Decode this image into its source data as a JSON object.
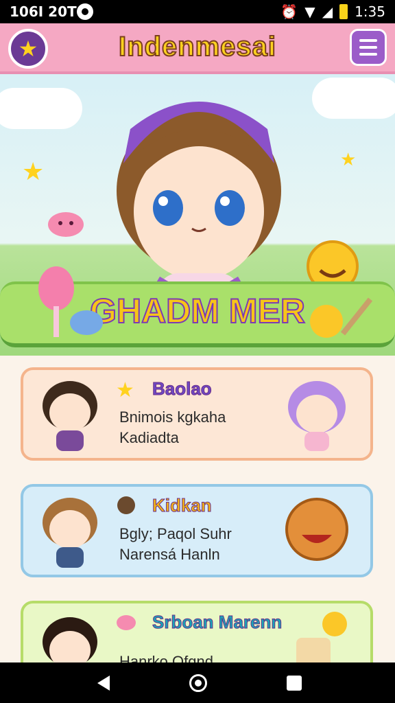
{
  "status": {
    "time_left": "106I 20T",
    "time_right": "1:35"
  },
  "appbar": {
    "title": "Indenmesai",
    "back_icon": "star-icon",
    "menu_icon": "hamburger-icon"
  },
  "hero": {
    "banner_text": "GHADM MER"
  },
  "cards": [
    {
      "heading": "Baolao",
      "line1": "Bnimois kgkaha",
      "line2": "Kadiadta",
      "heading_color": "#6d49c4"
    },
    {
      "heading": "Kidkan",
      "line1": "Bgly; Paqol  Suhr",
      "line2": "Narensá Hanln",
      "heading_color": "#f2b516"
    },
    {
      "heading": "Srboan Marenn",
      "line1": "Hanrko Ofgnd",
      "line2": "",
      "heading_color": "#19a7b8"
    }
  ],
  "navbar": {
    "back": "back-icon",
    "home": "home-icon",
    "recents": "recents-icon"
  }
}
